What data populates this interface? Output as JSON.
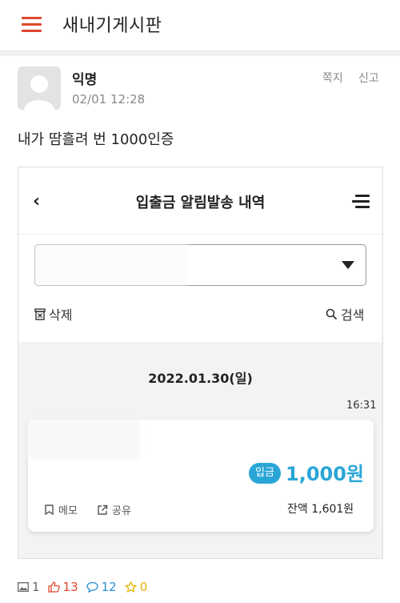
{
  "header": {
    "title": "새내기게시판"
  },
  "post": {
    "author": "익명",
    "time": "02/01 12:28",
    "message_label": "쪽지",
    "report_label": "신고",
    "body": "내가 땀흘려 번 1000인증"
  },
  "screenshot": {
    "title": "입출금 알림발송 내역",
    "back_icon": "chevron-left-icon",
    "delete_label": "삭제",
    "search_label": "검색",
    "date": "2022.01.30(일)",
    "transaction": {
      "time": "16:31",
      "badge": "입금",
      "amount": "1,000원",
      "memo_label": "메모",
      "share_label": "공유",
      "balance": "잔액 1,601원"
    }
  },
  "stats": {
    "images": "1",
    "likes": "13",
    "comments": "12",
    "scraps": "0"
  },
  "colors": {
    "accent": "#e0472d",
    "deposit": "#2aa6d6",
    "comment": "#2a8fd6",
    "star": "#e6b400"
  }
}
